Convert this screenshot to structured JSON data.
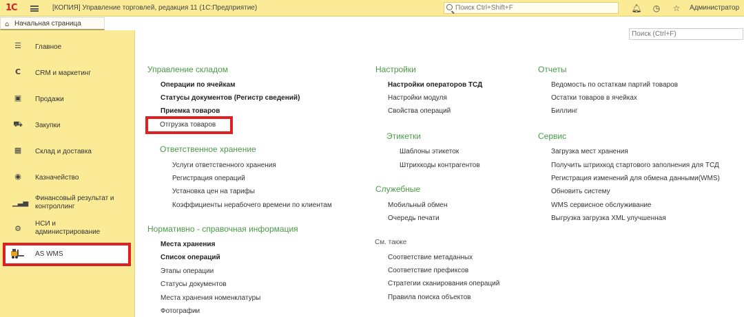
{
  "topbar": {
    "logo": "1С",
    "title": "[КОПИЯ] Управление торговлей, редакция 11  (1С:Предприятие)",
    "search_placeholder": "Поиск Ctrl+Shift+F",
    "user": "Администратор",
    "icons": [
      "bell-icon",
      "history-icon",
      "star-icon"
    ]
  },
  "tabs": {
    "home": "Начальная страница"
  },
  "sidebar": {
    "items": [
      {
        "label": "Главное",
        "icon": "menu-lines-icon"
      },
      {
        "label": "CRM и маркетинг",
        "icon": "crm-icon"
      },
      {
        "label": "Продажи",
        "icon": "bag-icon"
      },
      {
        "label": "Закупки",
        "icon": "cart-icon"
      },
      {
        "label": "Склад и доставка",
        "icon": "warehouse-grid-icon"
      },
      {
        "label": "Казначейство",
        "icon": "coin-icon"
      },
      {
        "label": "Финансовый результат и контроллинг",
        "icon": "bar-chart-icon"
      },
      {
        "label": "НСИ и администрирование",
        "icon": "gear-icon"
      },
      {
        "label": "AS WMS",
        "icon": "forklift-icon",
        "active": true
      }
    ]
  },
  "content": {
    "search_placeholder": "Поиск (Ctrl+F)",
    "col1": {
      "warehouse": {
        "title": "Управление складом",
        "links": [
          "Операции по ячейкам",
          "Статусы документов (Регистр сведений)",
          "Приемка товаров",
          "Отгрузка товаров"
        ]
      },
      "custody": {
        "title": "Ответственное хранение",
        "links": [
          "Услуги ответственного хранения",
          "Регистрация операций",
          "Установка цен на тарифы",
          "Коэффициенты нерабочего времени по клиентам"
        ]
      },
      "reference": {
        "title": "Нормативно - справочная информация",
        "links": [
          "Места хранения",
          "Список операций",
          "Этапы операции",
          "Статусы документов",
          "Места хранения номенклатуры",
          "Фотографии"
        ]
      }
    },
    "col2": {
      "settings": {
        "title": "Настройки",
        "links": [
          "Настройки операторов ТСД",
          "Настройки модуля",
          "Свойства операций"
        ]
      },
      "labels": {
        "title": "Этикетки",
        "links": [
          "Шаблоны этикеток",
          "Штрихкоды контрагентов"
        ]
      },
      "service_section": {
        "title": "Служебные",
        "links": [
          "Мобильный обмен",
          "Очередь печати"
        ]
      },
      "see_also": {
        "title": "См. также",
        "links": [
          "Соответствие метаданных",
          "Соответствие префиксов",
          "Стратегии сканирования операций",
          "Правила поиска объектов"
        ]
      }
    },
    "col3": {
      "reports": {
        "title": "Отчеты",
        "links": [
          "Ведомость по остаткам партий товаров",
          "Остатки товаров в ячейках",
          "Биллинг"
        ]
      },
      "service": {
        "title": "Сервис",
        "links": [
          "Загрузка мест хранения",
          "Получить штрихкод стартового заполнения для ТСД",
          "Регистрация изменений для обмена данными(WMS)",
          "Обновить систему",
          "WMS сервисное обслуживание",
          "Выгрузка загрузка XML улучшенная"
        ]
      }
    }
  },
  "colors": {
    "topbar_bg": "#fbeb96",
    "section_title": "#4a9a46",
    "highlight": "#e02020"
  }
}
